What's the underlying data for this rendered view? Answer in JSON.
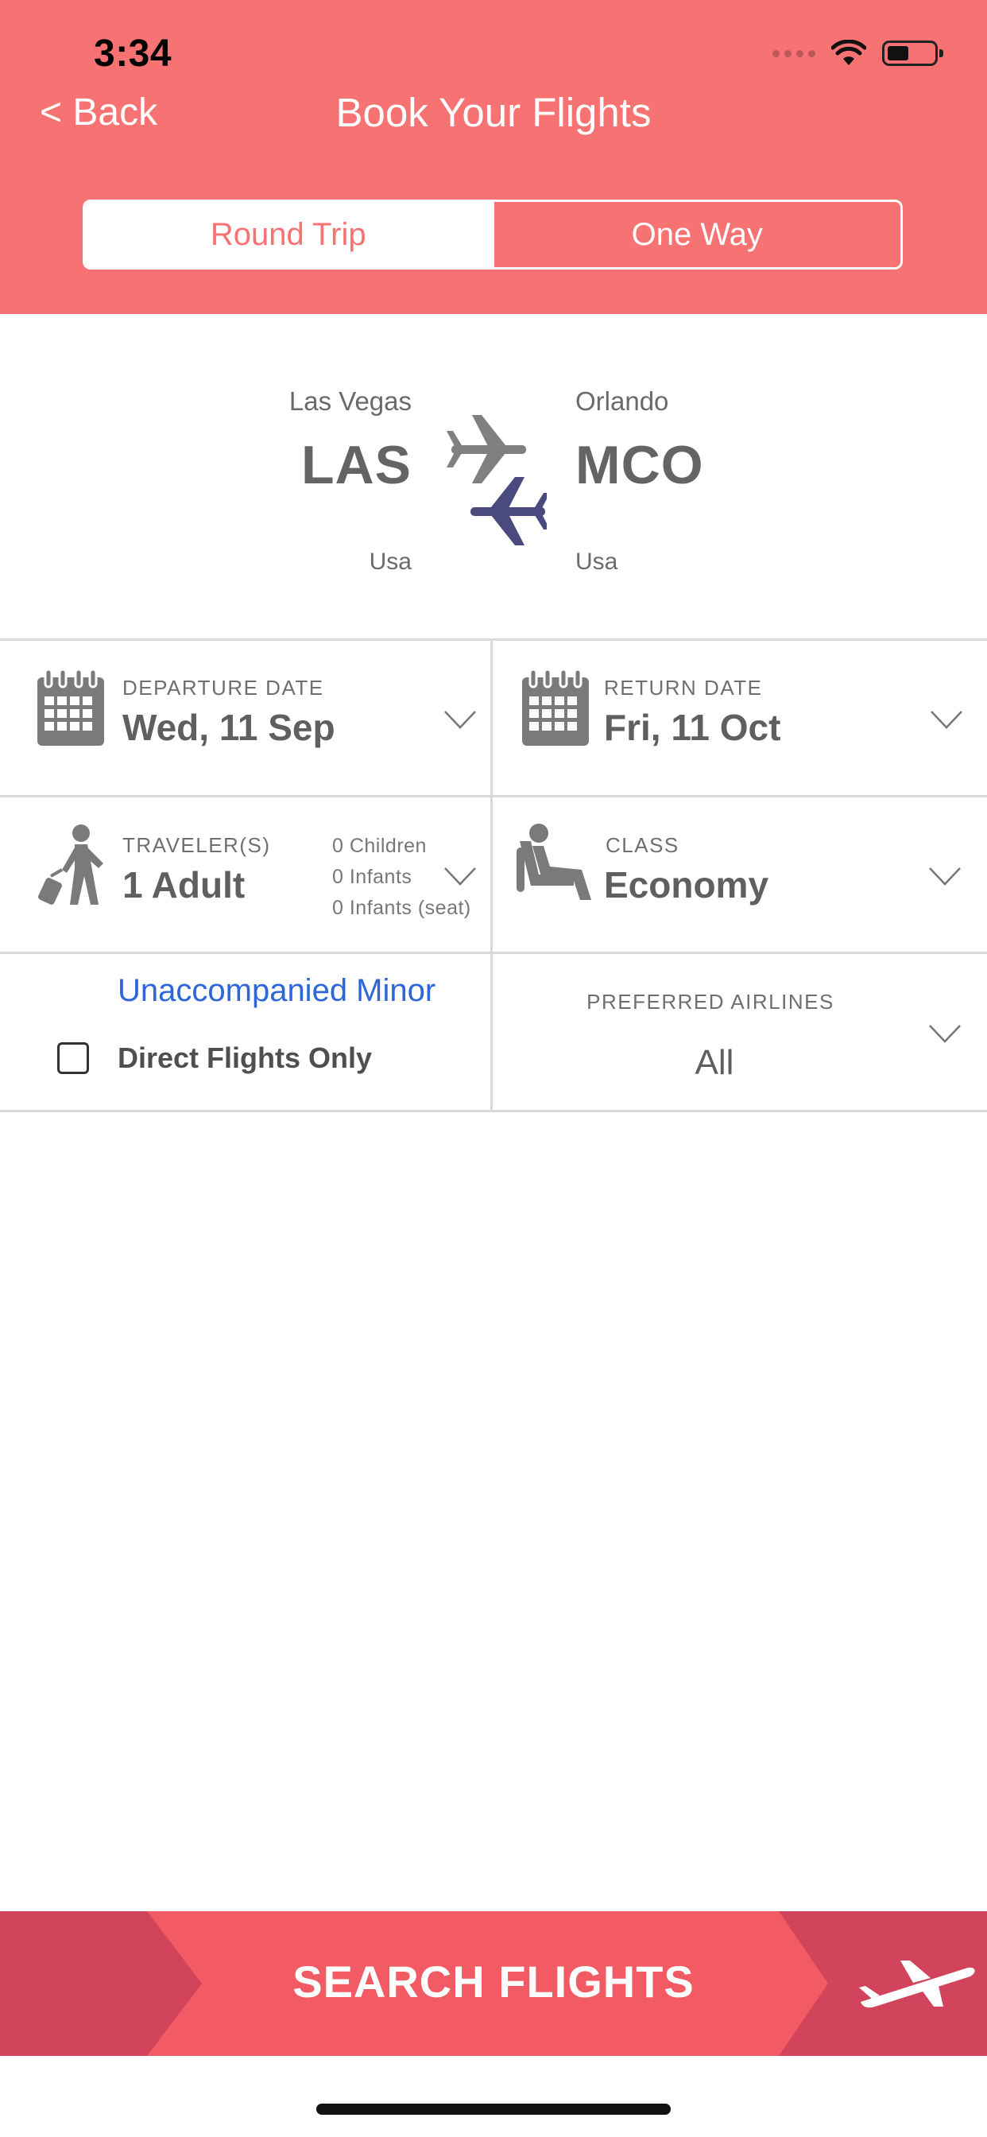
{
  "status_bar": {
    "time": "3:34"
  },
  "header": {
    "back_label": "< Back",
    "title": "Book Your Flights",
    "trip_types": [
      "Round Trip",
      "One Way"
    ],
    "selected_trip_type": "Round Trip"
  },
  "route": {
    "origin": {
      "city": "Las Vegas",
      "code": "LAS",
      "country": "Usa"
    },
    "destination": {
      "city": "Orlando",
      "code": "MCO",
      "country": "Usa"
    }
  },
  "dates": {
    "departure_label": "DEPARTURE DATE",
    "departure_value": "Wed, 11 Sep",
    "return_label": "RETURN DATE",
    "return_value": "Fri, 11 Oct"
  },
  "travelers": {
    "label": "TRAVELER(S)",
    "value": "1 Adult",
    "children": "0 Children",
    "infants": "0 Infants",
    "infants_seat": "0 Infants (seat)"
  },
  "class": {
    "label": "CLASS",
    "value": "Economy"
  },
  "options": {
    "unaccompanied_minor": "Unaccompanied Minor",
    "direct_flights": "Direct Flights Only",
    "direct_checked": false
  },
  "airlines": {
    "label": "PREFERRED AIRLINES",
    "value": "All"
  },
  "footer": {
    "search_label": "SEARCH FLIGHTS"
  },
  "colors": {
    "header_bg": "#f77373",
    "search_bg": "#f25b64",
    "search_shade": "#d2435c",
    "link_blue": "#2c66d9",
    "plane_gray": "#808080",
    "plane_navy": "#4b4a7e"
  },
  "icons": {
    "departure": "calendar-icon",
    "return": "calendar-icon",
    "travelers": "traveler-luggage-icon",
    "class": "seat-icon",
    "route": "planes-swap-icon",
    "search": "plane-takeoff-icon"
  }
}
